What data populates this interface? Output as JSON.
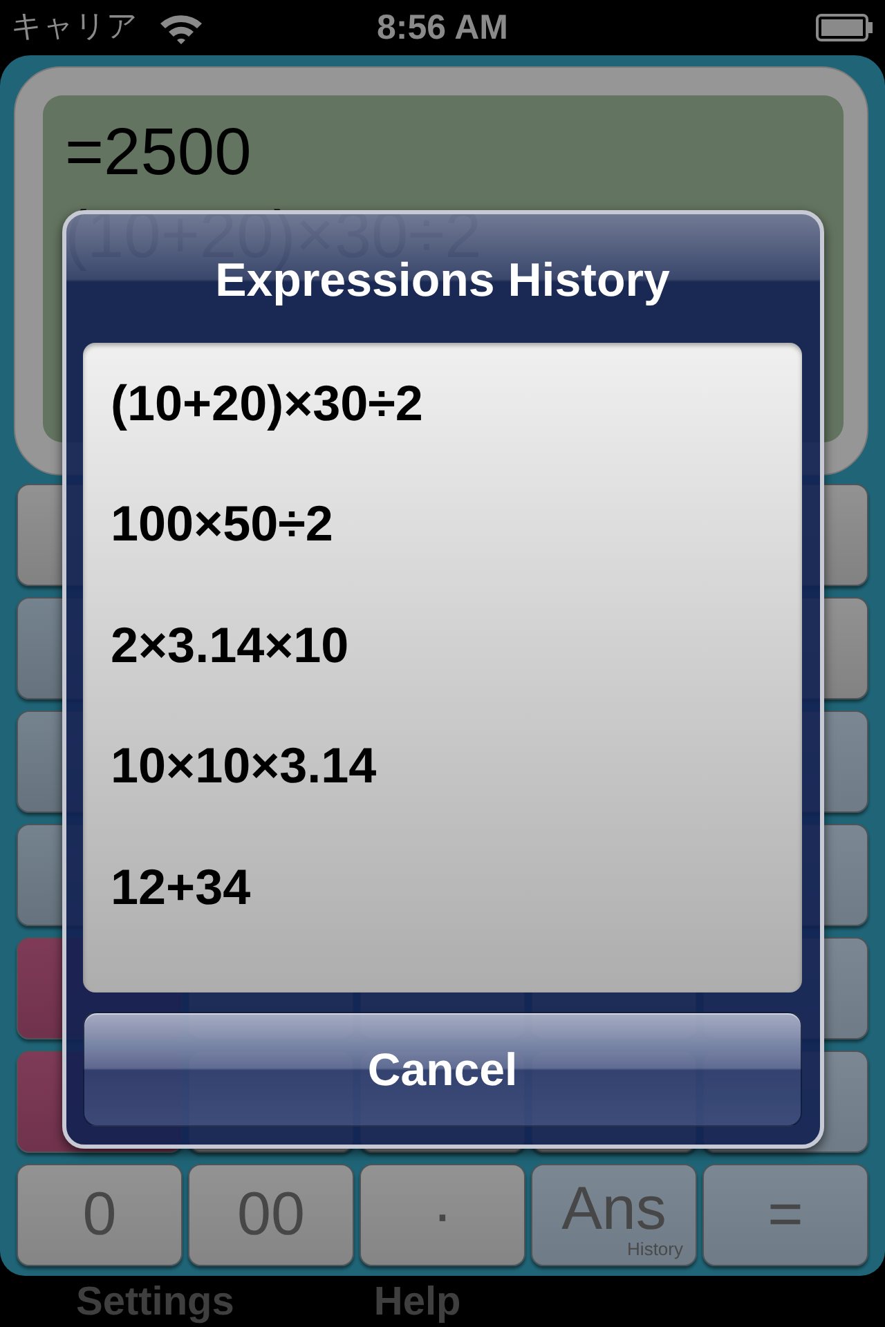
{
  "status_bar": {
    "carrier": "キャリア",
    "time": "8:56 AM"
  },
  "display": {
    "lines": [
      "=2500",
      "(10+20)×30÷2"
    ]
  },
  "keypad": {
    "rows": [
      {
        "keys": [
          {
            "kind": "function"
          },
          {
            "kind": "function"
          }
        ]
      },
      {
        "keys": [
          {
            "kind": "memory"
          },
          {
            "kind": "function"
          }
        ]
      },
      {
        "keys": [
          {
            "kind": "memory"
          },
          {
            "kind": "operator"
          }
        ]
      },
      {
        "keys": [
          {
            "kind": "memory"
          },
          {
            "kind": "operator"
          }
        ]
      },
      {
        "keys": [
          {
            "kind": "clear"
          },
          {
            "kind": "digit"
          },
          {
            "kind": "digit"
          },
          {
            "kind": "digit"
          },
          {
            "kind": "operator"
          }
        ]
      },
      {
        "keys": [
          {
            "kind": "clear"
          },
          {
            "kind": "digit"
          },
          {
            "kind": "digit"
          },
          {
            "kind": "digit"
          },
          {
            "kind": "operator"
          }
        ]
      },
      {
        "keys": [
          {
            "kind": "digit",
            "label": "0"
          },
          {
            "kind": "digit",
            "label": "00"
          },
          {
            "kind": "digit",
            "label": "·"
          },
          {
            "kind": "operator",
            "label": "Ans",
            "sublabel": "History"
          },
          {
            "kind": "operator",
            "label": "="
          }
        ]
      }
    ]
  },
  "dialog": {
    "title": "Expressions History",
    "items": [
      "(10+20)×30÷2",
      "100×50÷2",
      "2×3.14×10",
      "10×10×3.14",
      "12+34"
    ],
    "cancel": "Cancel"
  },
  "tab_bar": {
    "items": [
      {
        "label": "Settings"
      },
      {
        "label": "Help"
      }
    ]
  }
}
